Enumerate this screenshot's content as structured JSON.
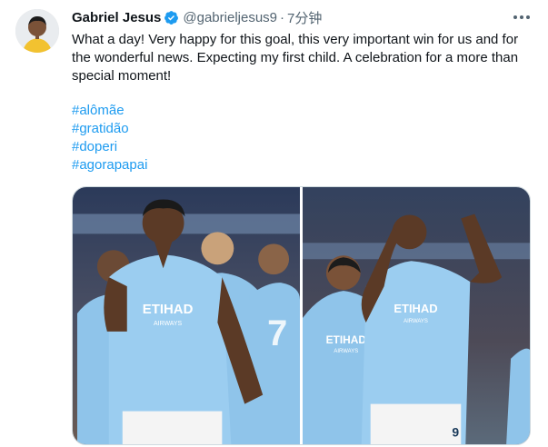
{
  "author": {
    "name": "Gabriel Jesus",
    "handle": "@gabrieljesus9",
    "time": "7分钟",
    "verified": true
  },
  "tweet": {
    "line1": "What a day! Very happy for this goal, this very important win for us and for",
    "line2": "the wonderful news. Expecting my first child. A celebration for a more than",
    "line3": "special moment!",
    "hashtags": [
      "#alômãe",
      "#gratidão",
      "#doperi",
      "#agorapapai"
    ]
  },
  "photos": [
    {
      "sponsor": "ETIHAD",
      "sponsor_sub": "AIRWAYS",
      "number": "7"
    },
    {
      "sponsor": "ETIHAD",
      "sponsor_sub": "AIRWAYS",
      "number": "9"
    }
  ],
  "icons": {
    "more": "more-horizontal-icon",
    "verified": "verified-badge-icon"
  },
  "colors": {
    "link": "#1d9bf0",
    "verified": "#1d9bf0",
    "secondary_text": "#536471",
    "kit_blue": "#8fc4ea"
  }
}
